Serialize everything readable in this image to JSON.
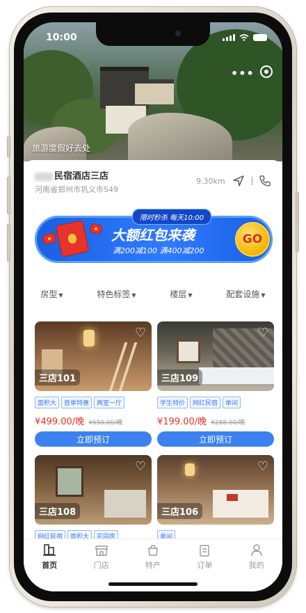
{
  "status_bar": {
    "time": "10:00"
  },
  "hero": {
    "caption": "旅游度假好去处"
  },
  "shop": {
    "name": "民宿酒店三店",
    "address": "河南省郑州市巩义市S49",
    "distance": "9.30km",
    "icons": [
      "navigation-icon",
      "phone-icon"
    ]
  },
  "banner": {
    "tag": "限时秒杀 每天10:00",
    "title": "大额红包来袭",
    "subtitle": "满200减100 满400减200",
    "go_label": "GO",
    "colors": {
      "blue": "#2f7bff",
      "gold": "#f5b400",
      "red": "#e8332a"
    }
  },
  "filters": [
    "房型",
    "特色标签",
    "楼层",
    "配套设施"
  ],
  "rooms": [
    {
      "name": "三店101",
      "tags": [
        "面积大",
        "首单特惠",
        "两室一厅"
      ],
      "price": "¥499.00/晚",
      "original": "¥650.00/晚",
      "book_label": "立即预订"
    },
    {
      "name": "三店109",
      "tags": [
        "学生特价",
        "网红民宿",
        "单间"
      ],
      "price": "¥199.00/晚",
      "original": "¥288.00/晚",
      "book_label": "立即预订"
    },
    {
      "name": "三店108",
      "tags": [
        "网红民宿",
        "面积大",
        "花园房"
      ]
    },
    {
      "name": "三店106",
      "tags": [
        "单间"
      ]
    }
  ],
  "tabbar": [
    {
      "label": "首页",
      "icon": "home-icon",
      "active": true
    },
    {
      "label": "门店",
      "icon": "store-icon",
      "active": false
    },
    {
      "label": "特产",
      "icon": "bag-icon",
      "active": false
    },
    {
      "label": "订单",
      "icon": "order-icon",
      "active": false
    },
    {
      "label": "我的",
      "icon": "user-icon",
      "active": false
    }
  ],
  "colors": {
    "accent": "#3b82f0",
    "price": "#e6322b"
  }
}
